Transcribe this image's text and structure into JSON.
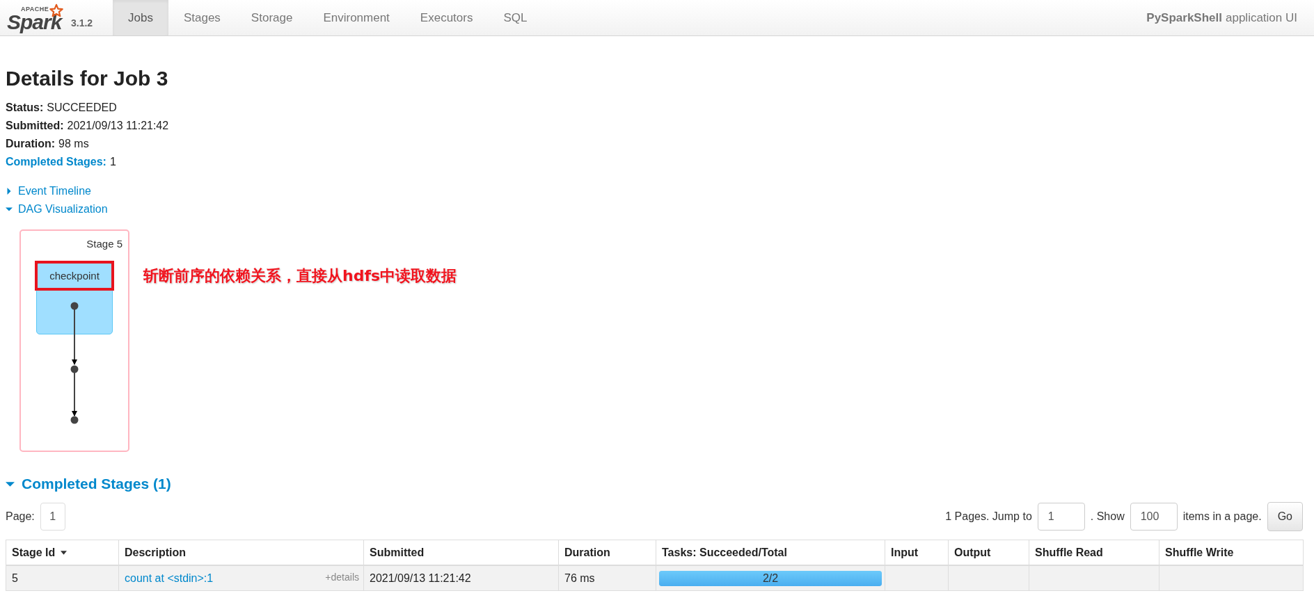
{
  "nav": {
    "logo": {
      "small": "APACHE",
      "name": "Spark",
      "version": "3.1.2"
    },
    "tabs": [
      {
        "label": "Jobs",
        "selected": true
      },
      {
        "label": "Stages",
        "selected": false
      },
      {
        "label": "Storage",
        "selected": false
      },
      {
        "label": "Environment",
        "selected": false
      },
      {
        "label": "Executors",
        "selected": false
      },
      {
        "label": "SQL",
        "selected": false
      }
    ],
    "app_name": "PySparkShell",
    "app_suffix": "application UI"
  },
  "heading": "Details for Job 3",
  "summary": [
    {
      "label": "Status:",
      "value": "SUCCEEDED",
      "kind": "plain"
    },
    {
      "label": "Submitted:",
      "value": "2021/09/13 11:21:42",
      "kind": "plain"
    },
    {
      "label": "Duration:",
      "value": "98 ms",
      "kind": "plain"
    },
    {
      "label": "Completed Stages:",
      "value": "1",
      "kind": "link"
    }
  ],
  "toggles": [
    {
      "label": "Event Timeline",
      "expanded": false
    },
    {
      "label": "DAG Visualization",
      "expanded": true
    }
  ],
  "dag": {
    "stage_label": "Stage 5",
    "node_label": "checkpoint",
    "highlighted": true,
    "annotation": "斩断前序的依赖关系，直接从hdfs中读取数据"
  },
  "stages_section": {
    "title": "Completed Stages (1)",
    "expanded": true,
    "page_label": "Page:",
    "page_button": "1",
    "pages_text": "1 Pages. Jump to",
    "jump_value": "1",
    "show_text": ". Show",
    "show_value": "100",
    "items_text": "items in a page.",
    "go": "Go"
  },
  "table": {
    "columns": [
      {
        "label": "Stage Id",
        "sorted": true
      },
      {
        "label": "Description",
        "sorted": false
      },
      {
        "label": "Submitted",
        "sorted": false
      },
      {
        "label": "Duration",
        "sorted": false
      },
      {
        "label": "Tasks: Succeeded/Total",
        "sorted": false
      },
      {
        "label": "Input",
        "sorted": false
      },
      {
        "label": "Output",
        "sorted": false
      },
      {
        "label": "Shuffle Read",
        "sorted": false
      },
      {
        "label": "Shuffle Write",
        "sorted": false
      }
    ],
    "rows": [
      {
        "stage_id": "5",
        "description": "count at <stdin>:1",
        "details": "+details",
        "submitted": "2021/09/13 11:21:42",
        "duration": "76 ms",
        "tasks": {
          "text": "2/2",
          "level": 1
        }
      }
    ]
  }
}
